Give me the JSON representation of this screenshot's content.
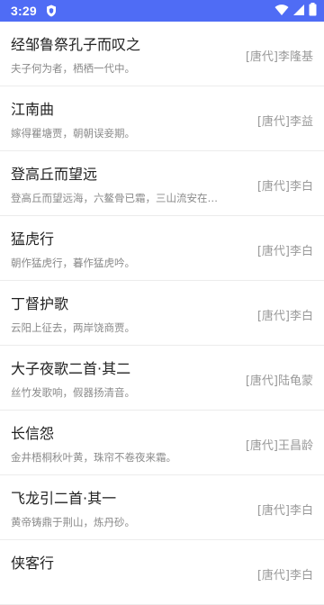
{
  "status_bar": {
    "time": "3:29",
    "icons": [
      "shield-icon",
      "wifi-icon",
      "signal-icon",
      "battery-icon"
    ]
  },
  "colors": {
    "status_bar_bg": "#4f6cf5",
    "title_text": "#222222",
    "excerpt_text": "#8a8a8a",
    "author_text": "#9a9a9a",
    "divider": "#ececec"
  },
  "poems": [
    {
      "title": "经邹鲁祭孔子而叹之",
      "excerpt": "夫子何为者，栖栖一代中。",
      "author": "[唐代]李隆基"
    },
    {
      "title": "江南曲",
      "excerpt": "嫁得瞿塘贾，朝朝误妾期。",
      "author": "[唐代]李益"
    },
    {
      "title": "登高丘而望远",
      "excerpt": "登高丘而望远海，六鳌骨已霜，三山流安在…",
      "author": "[唐代]李白"
    },
    {
      "title": "猛虎行",
      "excerpt": "朝作猛虎行，暮作猛虎吟。",
      "author": "[唐代]李白"
    },
    {
      "title": "丁督护歌",
      "excerpt": "云阳上征去，两岸饶商贾。",
      "author": "[唐代]李白"
    },
    {
      "title": "大子夜歌二首·其二",
      "excerpt": "丝竹发歌响，假器扬清音。",
      "author": "[唐代]陆龟蒙"
    },
    {
      "title": "长信怨",
      "excerpt": "金井梧桐秋叶黄，珠帘不卷夜来霜。",
      "author": "[唐代]王昌龄"
    },
    {
      "title": "飞龙引二首·其一",
      "excerpt": "黄帝铸鼎于荆山，炼丹砂。",
      "author": "[唐代]李白"
    },
    {
      "title": "侠客行",
      "excerpt": "",
      "author": "[唐代]李白"
    }
  ]
}
